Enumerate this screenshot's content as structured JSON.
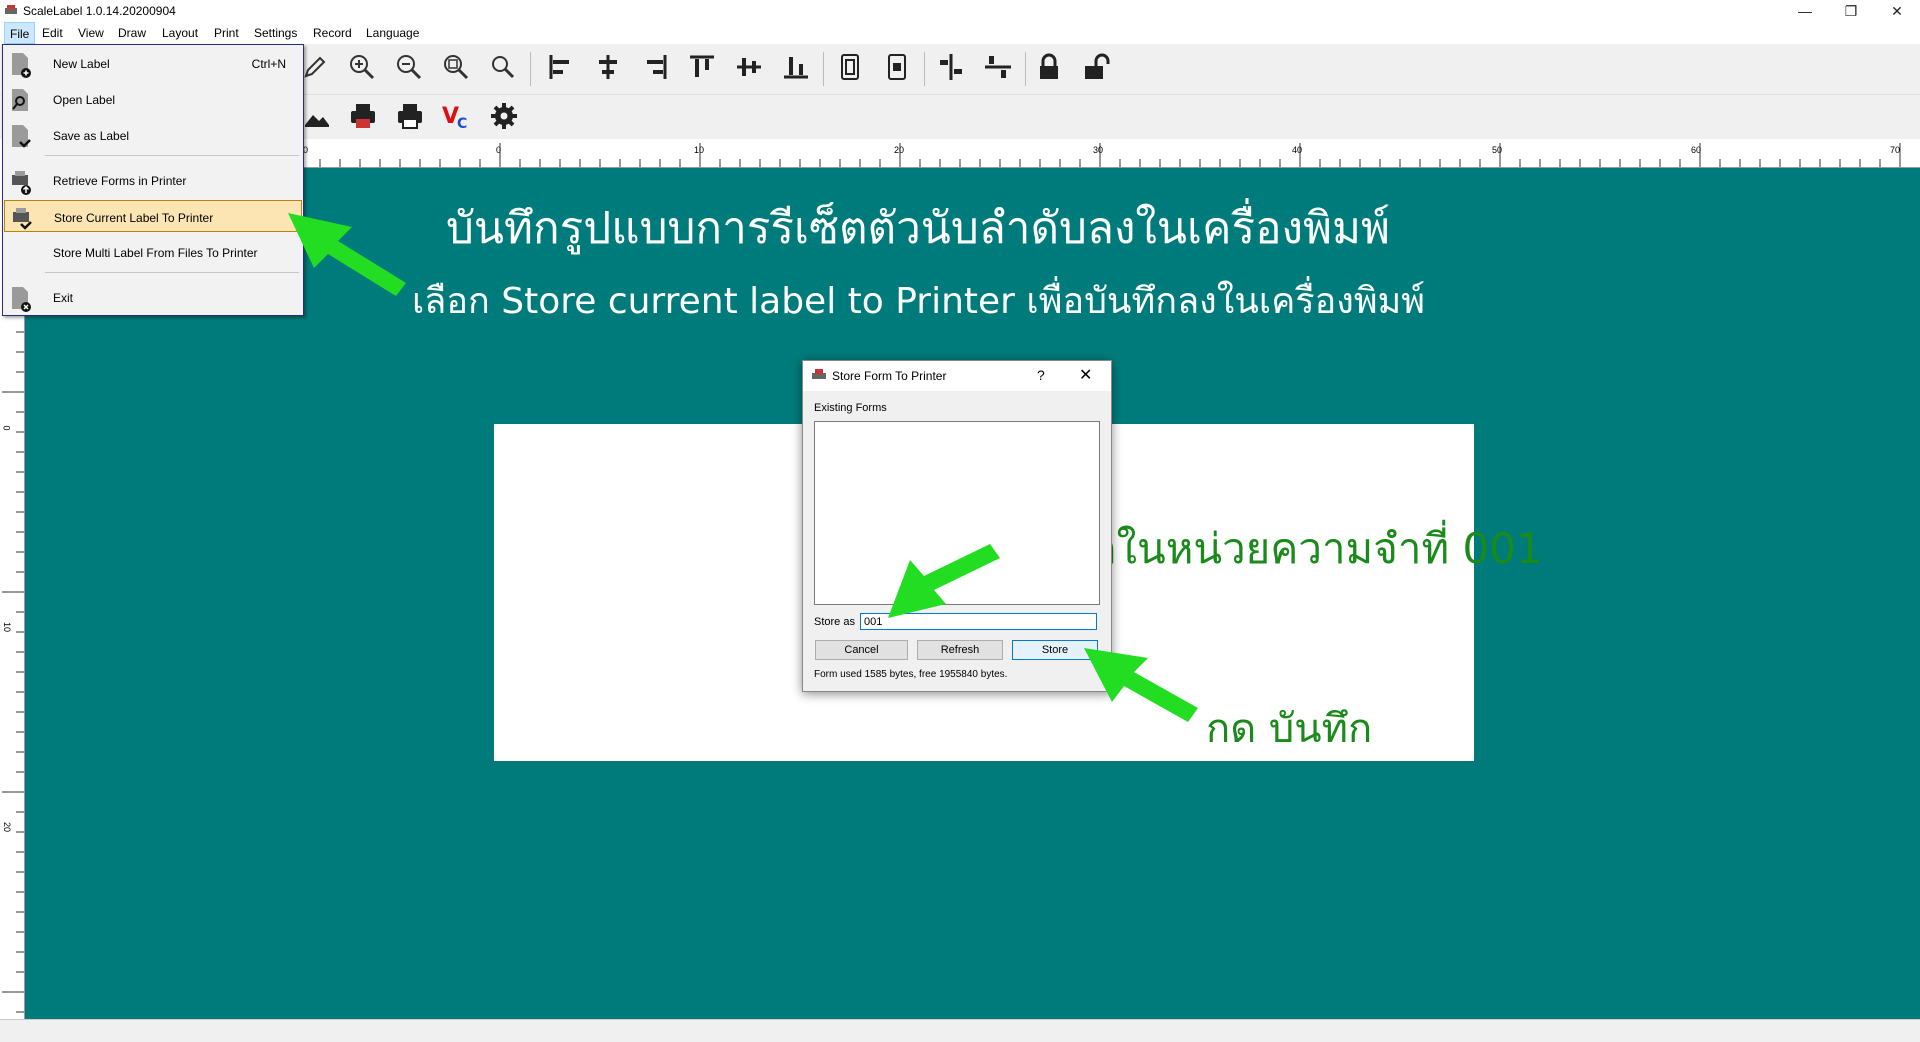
{
  "window": {
    "title": "ScaleLabel 1.0.14.20200904",
    "controls": {
      "minimize": "—",
      "restore": "❐",
      "close": "✕"
    }
  },
  "menubar": [
    "File",
    "Edit",
    "View",
    "Draw",
    "Layout",
    "Print",
    "Settings",
    "Record",
    "Language"
  ],
  "file_menu": {
    "items": [
      {
        "label": "New Label",
        "shortcut": "Ctrl+N",
        "icon": "new-label-icon"
      },
      {
        "label": "Open Label",
        "shortcut": "",
        "icon": "open-label-icon"
      },
      {
        "label": "Save as Label",
        "shortcut": "",
        "icon": "save-label-icon"
      },
      {
        "label": "Retrieve Forms in Printer",
        "shortcut": "",
        "icon": "retrieve-forms-icon"
      },
      {
        "label": "Store Current Label To Printer",
        "shortcut": "",
        "icon": "store-label-icon"
      },
      {
        "label": "Store Multi Label From Files To Printer",
        "shortcut": "",
        "icon": ""
      },
      {
        "label": "Exit",
        "shortcut": "",
        "icon": "exit-icon"
      }
    ],
    "highlighted": "Store Current Label To Printer"
  },
  "toolbar1_icons": [
    "pen-icon",
    "zoom-in-icon",
    "zoom-out-icon",
    "zoom-fit-icon",
    "zoom-actual-icon",
    "align-left-icon",
    "align-center-icon",
    "align-right-icon",
    "align-top-icon",
    "align-middle-icon",
    "align-bottom-icon",
    "page-front-icon",
    "page-back-icon",
    "distribute-horizontal-icon",
    "distribute-vertical-icon",
    "lock-icon",
    "unlock-icon"
  ],
  "toolbar2_icons": [
    "image-icon",
    "print-preview-icon",
    "print-icon",
    "vc-icon",
    "settings-gear-icon"
  ],
  "ruler": {
    "top_labels": [
      "0",
      "10",
      "20",
      "30",
      "40",
      "50",
      "60",
      "70"
    ],
    "left_labels": [
      "0",
      "10",
      "20"
    ]
  },
  "annotations": {
    "heading": "บันทึกรูปแบบการรีเซ็ตตัวนับลำดับลงในเครื่องพิมพ์",
    "subheading": "เลือก Store current label to Printer เพื่อบันทึกลงในเครื่องพิมพ์",
    "memory_note": "บันทึกในหน่วยความจำที่ 001",
    "press_store": "กด บันทึก"
  },
  "dialog": {
    "title": "Store Form To Printer",
    "help": "?",
    "close": "✕",
    "existing_forms_label": "Existing Forms",
    "existing_forms": [],
    "store_as_label": "Store as",
    "store_as_value": "001",
    "buttons": {
      "cancel": "Cancel",
      "refresh": "Refresh",
      "store": "Store"
    },
    "status": "Form used 1585 bytes, free 1955840 bytes."
  },
  "colors": {
    "canvas": "#007b7b",
    "arrow": "#22dd22",
    "annotation_green": "#1a8a1a",
    "menu_highlight": "#fde5b3"
  }
}
